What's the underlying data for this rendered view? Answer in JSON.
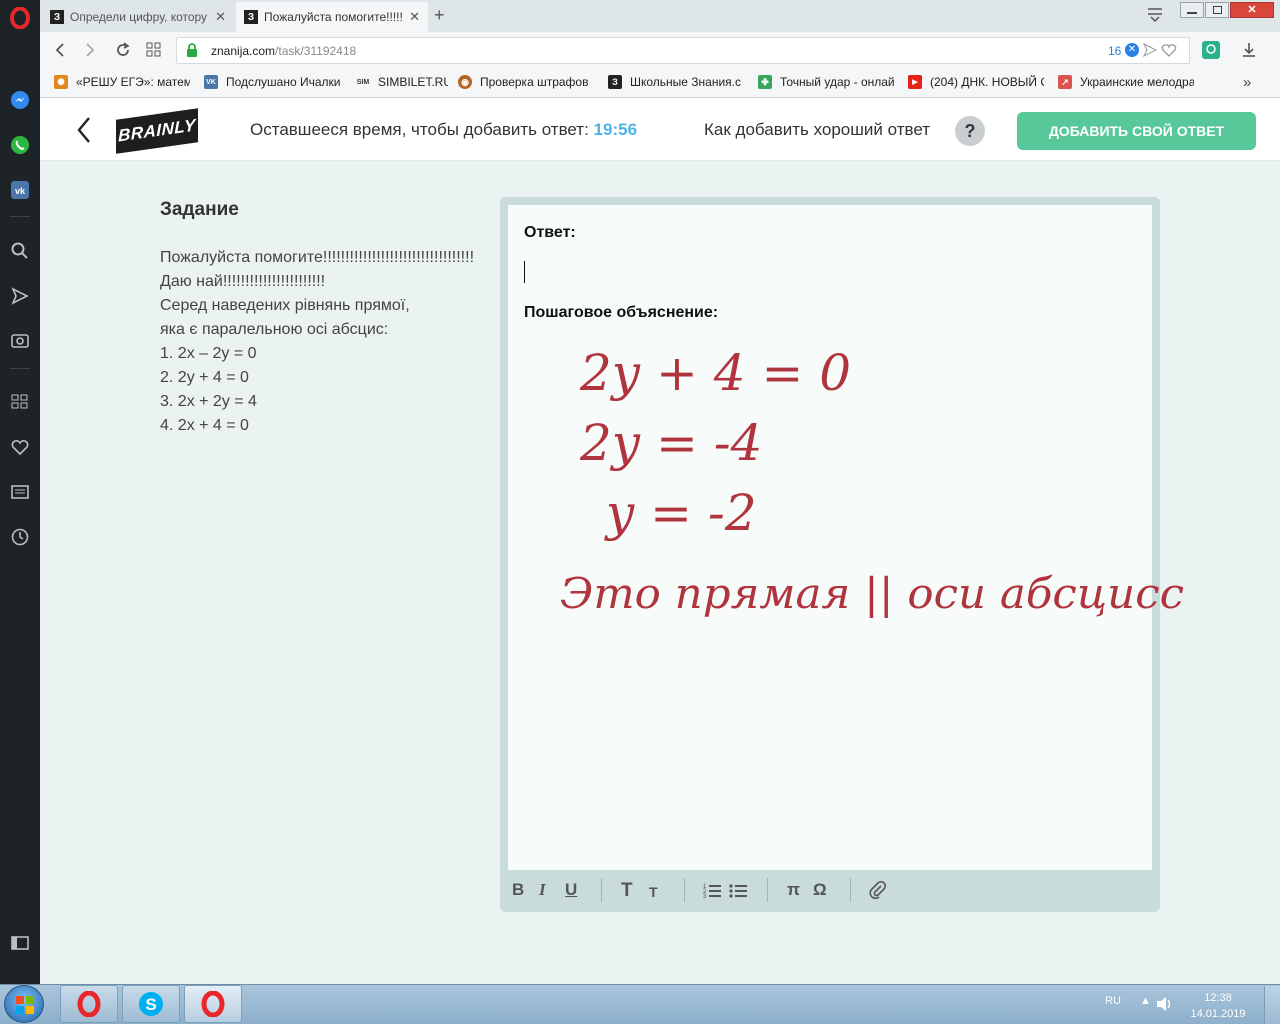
{
  "browser": {
    "tabs": [
      {
        "label": "Определи цифру, котору",
        "favicon": "З"
      },
      {
        "label": "Пожалуйста помогите!!!!!",
        "favicon": "З"
      }
    ],
    "new_tab_icon": "plus-icon",
    "url": "znanija.com/task/31192418",
    "url_domain": "znanija.com",
    "url_path": "/task/31192418",
    "adblock_count": "16",
    "bookmarks": [
      {
        "label": "«РЕШУ ЕГЭ»: матема",
        "icon_color": "#e08a1e"
      },
      {
        "label": "Подслушано Ичалки",
        "icon_color": "#4a76a8"
      },
      {
        "label": "SIMBILET.RU",
        "icon_color": "#333333"
      },
      {
        "label": "Проверка штрафов",
        "icon_color": "#b5651d"
      },
      {
        "label": "Школьные Знания.с",
        "icon_color": "#222222"
      },
      {
        "label": "Точный удар - онлай",
        "icon_color": "#3aa55c"
      },
      {
        "label": "(204) ДНК. НОВЫЙ С",
        "icon_color": "#e62117"
      },
      {
        "label": "Украинские мелодра",
        "icon_color": "#d9534f"
      }
    ],
    "bookmark_icon_glyphs": [
      "✺",
      "VK",
      "SIM",
      "◉",
      "З",
      "✤",
      "▶",
      "↗"
    ],
    "bookmarks_more": "»"
  },
  "brainly": {
    "logo": "BRAINLY",
    "timer_label": "Оставшееся время, чтобы добавить ответ:",
    "timer_value": "19:56",
    "how_to_label": "Как добавить хороший ответ",
    "help_glyph": "?",
    "add_answer_button": "ДОБАВИТЬ СВОЙ ОТВЕТ",
    "accent_color": "#57c89a",
    "timer_color": "#4fb3e6"
  },
  "task": {
    "heading": "Задание",
    "lines": [
      "Пожалуйста помогите!!!!!!!!!!!!!!!!!!!!!!!!!!!!!!!!!!",
      "Даю най!!!!!!!!!!!!!!!!!!!!!!!",
      "Серед наведених рівнянь прямої,",
      "яка є паралельною осі абсцис:",
      "1. 2x – 2y = 0",
      "2. 2y + 4 = 0",
      "3. 2x + 2y = 4",
      "4. 2x + 4 = 0"
    ]
  },
  "editor": {
    "answer_label": "Ответ:",
    "explanation_label": "Пошаговое объяснение:",
    "handwritten": {
      "line1": "2y + 4 = 0",
      "line2": "2y = -4",
      "line3": "y = -2",
      "line4": "Это прямая || оси абсцисс"
    },
    "ink_color": "#b0343e",
    "toolbar": {
      "bold": "B",
      "italic": "I",
      "underline": "U",
      "text_large": "T",
      "text_small": "T",
      "ordered_list_icon": "ordered-list-icon",
      "bullet_list_icon": "bullet-list-icon",
      "pi": "π",
      "omega": "Ω",
      "attach_icon": "paperclip-icon"
    }
  },
  "taskbar": {
    "lang": "RU",
    "time": "12:38",
    "date": "14.01.2019"
  }
}
